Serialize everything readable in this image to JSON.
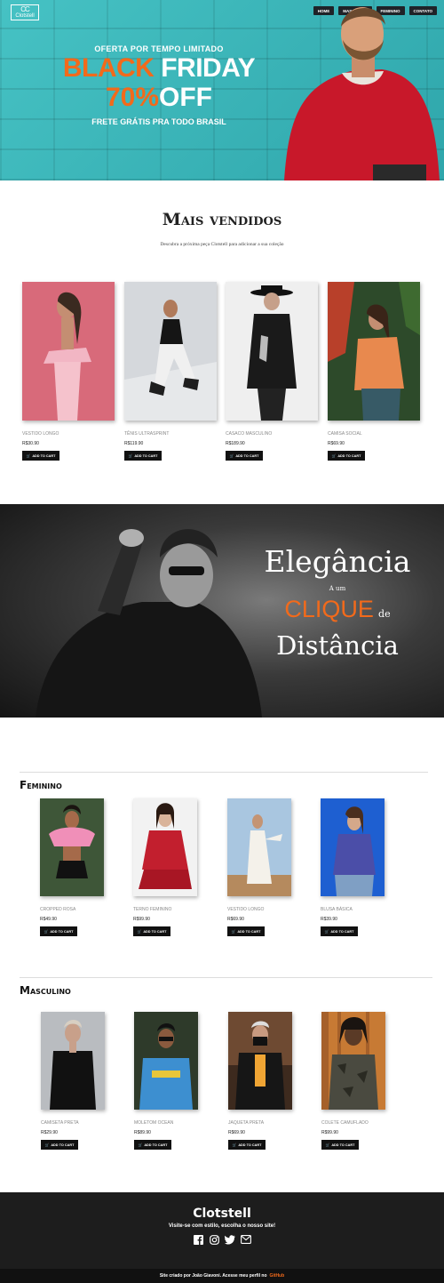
{
  "brand": {
    "logo_mark": "CC",
    "logo_text": "Clotstell"
  },
  "nav": [
    "HOME",
    "MASCULINO",
    "FEMININO",
    "CONTATO"
  ],
  "hero": {
    "subtitle": "OFERTA POR TEMPO LIMITADO",
    "black": "BLACK",
    "friday": "FRIDAY",
    "percent": "70%",
    "off": "OFF",
    "shipping": "FRETE GRÁTIS PRA TODO BRASIL"
  },
  "best": {
    "title": "Mais vendidos",
    "desc": "Descubra a próxima peça Clotstell para adicionar a sua coleção",
    "items": [
      {
        "name": "VESTIDO LONGO",
        "price": "R$30.90",
        "cart": "ADD TO CART"
      },
      {
        "name": "TÊNIS ULTRASPRINT",
        "price": "R$119.90",
        "cart": "ADD TO CART"
      },
      {
        "name": "CASACO MASCULINO",
        "price": "R$189.90",
        "cart": "ADD TO CART"
      },
      {
        "name": "CAMISA SOCIAL",
        "price": "R$69.90",
        "cart": "ADD TO CART"
      }
    ]
  },
  "banner": {
    "line1": "Elegância",
    "line2": "A um",
    "clique": "CLIQUE",
    "de": "de",
    "line4": "Distância"
  },
  "feminino": {
    "title": "Feminino",
    "items": [
      {
        "name": "CROPPED ROSA",
        "price": "R$49.90",
        "cart": "ADD TO CART"
      },
      {
        "name": "TERNO FEMININO",
        "price": "R$99.90",
        "cart": "ADD TO CART"
      },
      {
        "name": "VESTIDO LONGO",
        "price": "R$69.90",
        "cart": "ADD TO CART"
      },
      {
        "name": "BLUSA BÁSICA",
        "price": "R$39.90",
        "cart": "ADD TO CART"
      }
    ]
  },
  "masculino": {
    "title": "Masculino",
    "items": [
      {
        "name": "CAMISETA PRETA",
        "price": "R$29.90",
        "cart": "ADD TO CART"
      },
      {
        "name": "MOLETOM OCEAN",
        "price": "R$89.90",
        "cart": "ADD TO CART"
      },
      {
        "name": "JAQUETA PRETA",
        "price": "R$69.90",
        "cart": "ADD TO CART"
      },
      {
        "name": "COLETE CAMUFLADO",
        "price": "R$99.90",
        "cart": "ADD TO CART"
      }
    ]
  },
  "footer": {
    "title": "Clotstell",
    "subtitle": "Visite-se com estilo, escolha o nosso site!",
    "icons": [
      "facebook-icon",
      "instagram-icon",
      "twitter-icon",
      "mail-icon"
    ],
    "credit": "Site criado por João Giavoni. Acesse meu perfil no",
    "github": "GitHub"
  },
  "colors": {
    "accent": "#f26a1b",
    "teal": "#3fb9bd",
    "dark": "#1d1d1d"
  }
}
